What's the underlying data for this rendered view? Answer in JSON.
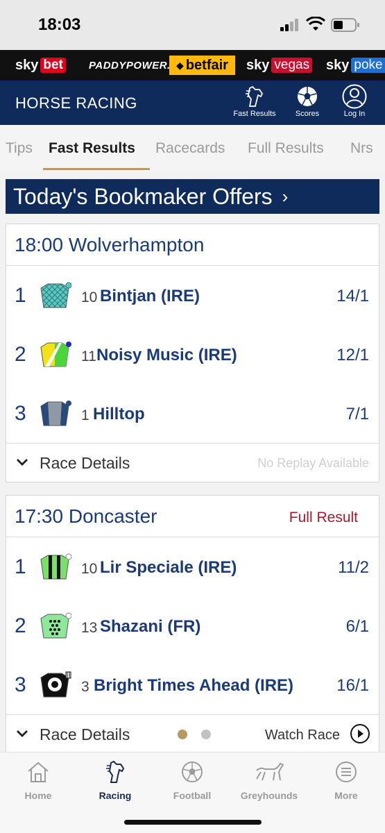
{
  "status_bar": {
    "time": "18:03"
  },
  "brands": {
    "skybet": {
      "sky": "sky",
      "bet": "bet"
    },
    "paddypower": "PADDYPOWER.",
    "betfair": "betfair",
    "skyvegas": {
      "sky": "sky",
      "vegas": "vegas"
    },
    "skypoker": {
      "sky": "sky",
      "poker": "poke"
    }
  },
  "header": {
    "title": "HORSE RACING",
    "fast_results": "Fast Results",
    "scores": "Scores",
    "login": "Log In"
  },
  "tabs": [
    "Tips",
    "Fast Results",
    "Racecards",
    "Full Results",
    "Nrs"
  ],
  "active_tab": "Fast Results",
  "offers_banner": {
    "label": "Today's Bookmaker Offers",
    "chevron": "›"
  },
  "races": [
    {
      "title": "18:00 Wolverhampton",
      "full_result": "",
      "runners": [
        {
          "pos": "1",
          "num": "10",
          "name": "Bintjan (IRE)",
          "odds": "14/1"
        },
        {
          "pos": "2",
          "num": "11",
          "name": "Noisy Music (IRE)",
          "odds": "12/1"
        },
        {
          "pos": "3",
          "num": "1",
          "name": "Hilltop",
          "odds": "7/1"
        }
      ],
      "details_label": "Race Details",
      "replay_label": "No Replay Available"
    },
    {
      "title": "17:30 Doncaster",
      "full_result": "Full Result",
      "runners": [
        {
          "pos": "1",
          "num": "10",
          "name": "Lir Speciale (IRE)",
          "odds": "11/2"
        },
        {
          "pos": "2",
          "num": "13",
          "name": "Shazani (FR)",
          "odds": "6/1"
        },
        {
          "pos": "3",
          "num": "3",
          "name": "Bright Times Ahead (IRE)",
          "odds": "16/1"
        }
      ],
      "details_label": "Race Details",
      "watch_label": "Watch Race"
    }
  ],
  "bottom_nav": [
    {
      "label": "Home",
      "icon": "home-icon"
    },
    {
      "label": "Racing",
      "icon": "horse-icon"
    },
    {
      "label": "Football",
      "icon": "football-icon"
    },
    {
      "label": "Greyhounds",
      "icon": "greyhound-icon"
    },
    {
      "label": "More",
      "icon": "menu-icon"
    }
  ],
  "colors": {
    "navy": "#0f2b5c",
    "accent_gold": "#b59a61",
    "result_red": "#a6192e",
    "text_blue": "#1b3a7a"
  }
}
